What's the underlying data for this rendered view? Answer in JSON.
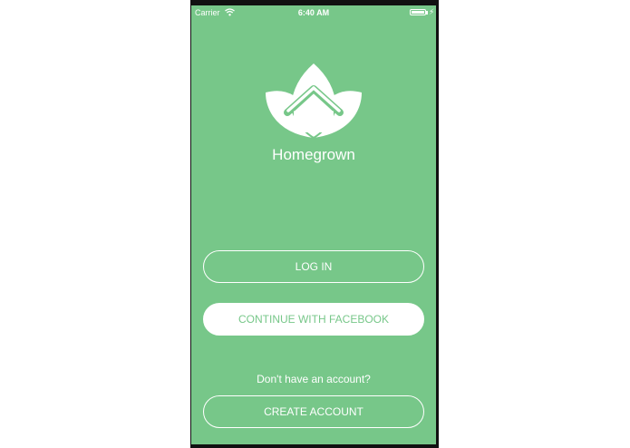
{
  "status_bar": {
    "carrier": "Carrier",
    "time": "6:40 AM",
    "wifi_icon": "wifi-icon",
    "battery_icon": "battery-icon"
  },
  "app": {
    "name": "Homegrown",
    "logo_icon": "leaf-house-logo-icon"
  },
  "buttons": {
    "login": "LOG IN",
    "facebook": "CONTINUE WITH FACEBOOK",
    "create_account": "CREATE ACCOUNT"
  },
  "signup_prompt": "Don't have an account?",
  "colors": {
    "background": "#77c789",
    "foreground": "#ffffff"
  }
}
